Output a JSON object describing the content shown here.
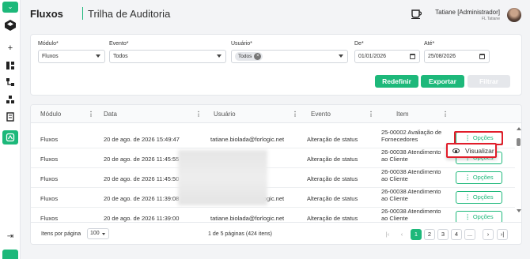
{
  "header": {
    "title": "Fluxos",
    "subtitle": "Trilha de Auditoria",
    "user_name": "Tatiane [Administrador]",
    "user_company": "FL Tatiane"
  },
  "filters": {
    "modulo": {
      "label": "Módulo*",
      "value": "Fluxos"
    },
    "evento": {
      "label": "Evento*",
      "value": "Todos"
    },
    "usuario": {
      "label": "Usuário*",
      "chip": "Todos"
    },
    "de": {
      "label": "De*",
      "value": "01/01/2026"
    },
    "ate": {
      "label": "Até*",
      "value": "25/08/2026"
    },
    "btn_redefinir": "Redefinir",
    "btn_exportar": "Exportar",
    "btn_filtrar": "Filtrar"
  },
  "table": {
    "columns": [
      "Módulo",
      "Data",
      "Usuário",
      "Evento",
      "Item"
    ],
    "rows": [
      {
        "modulo": "Fluxos",
        "data": "20 de ago. de 2026 15:49:47",
        "usuario": "tatiane.biolada@forlogic.net",
        "evento": "Alteração de status",
        "item": "25-00002 Avaliação de Fornecedores",
        "opcoes": "Opções"
      },
      {
        "modulo": "Fluxos",
        "data": "20 de ago. de 2026 11:45:55",
        "usuario": "",
        "evento": "Alteração de status",
        "item": "26-00038 Atendimento ao Cliente",
        "opcoes": "Opções"
      },
      {
        "modulo": "Fluxos",
        "data": "20 de ago. de 2026 11:45:50",
        "usuario": "",
        "evento": "Alteração de status",
        "item": "26-00038 Atendimento ao Cliente",
        "opcoes": "Opções"
      },
      {
        "modulo": "Fluxos",
        "data": "20 de ago. de 2026 11:39:08",
        "usuario": "tatiane.biolada@forlogic.net",
        "evento": "Alteração de status",
        "item": "26-00038 Atendimento ao Cliente",
        "opcoes": "Opções"
      },
      {
        "modulo": "Fluxos",
        "data": "20 de ago. de 2026 11:39:00",
        "usuario": "tatiane.biolada@forlogic.net",
        "evento": "Alteração de status",
        "item": "26-00038 Atendimento ao Cliente",
        "opcoes": "Opções"
      }
    ],
    "popover_label": "Visualizar"
  },
  "footer": {
    "per_page_label": "Itens por página",
    "per_page_value": "100",
    "page_info": "1 de 5 páginas (424 itens)",
    "pages": [
      "1",
      "2",
      "3",
      "4",
      "..."
    ],
    "current_page": "1"
  },
  "colors": {
    "accent": "#1db87a",
    "highlight": "#e11d2a"
  }
}
